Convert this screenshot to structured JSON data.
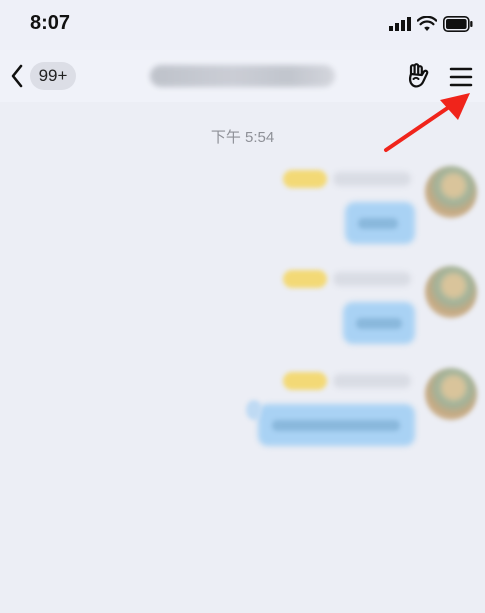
{
  "status_bar": {
    "time": "8:07",
    "icons": [
      "cellular-signal-icon",
      "wifi-icon",
      "battery-icon"
    ]
  },
  "header": {
    "back_icon": "chevron-left-icon",
    "unread_count": "99+",
    "title": "",
    "gesture_icon": "hand-gesture-icon",
    "menu_icon": "hamburger-menu-icon"
  },
  "chat": {
    "timestamp": "下午 5:54"
  },
  "annotation": {
    "arrow_icon": "red-arrow-icon",
    "arrow_color": "#f0241b"
  },
  "colors": {
    "background": "#edeff6",
    "bubble": "#a9d2f4",
    "tag": "#f3d976"
  }
}
